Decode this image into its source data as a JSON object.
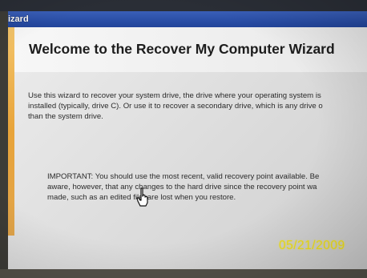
{
  "window": {
    "title": "izard"
  },
  "wizard": {
    "heading": "Welcome to the Recover My Computer Wizard",
    "intro": "Use this wizard to recover your system drive, the drive where your operating system is\ninstalled (typically, drive C). Or use it to recover a secondary drive, which is any drive o\nthan the system drive.",
    "important": "IMPORTANT: You should use the most recent, valid recovery point available. Be\naware, however, that any changes to the hard drive since the recovery point wa\nmade, such as an edited file, are lost when you restore."
  },
  "photo": {
    "date_stamp": "05/21/2009"
  },
  "icons": {
    "cursor": "hand-cursor-icon"
  },
  "colors": {
    "titlebar": "#2a4ea6",
    "accent_strip": "#e8a43a",
    "date_stamp": "#f2e21a"
  }
}
